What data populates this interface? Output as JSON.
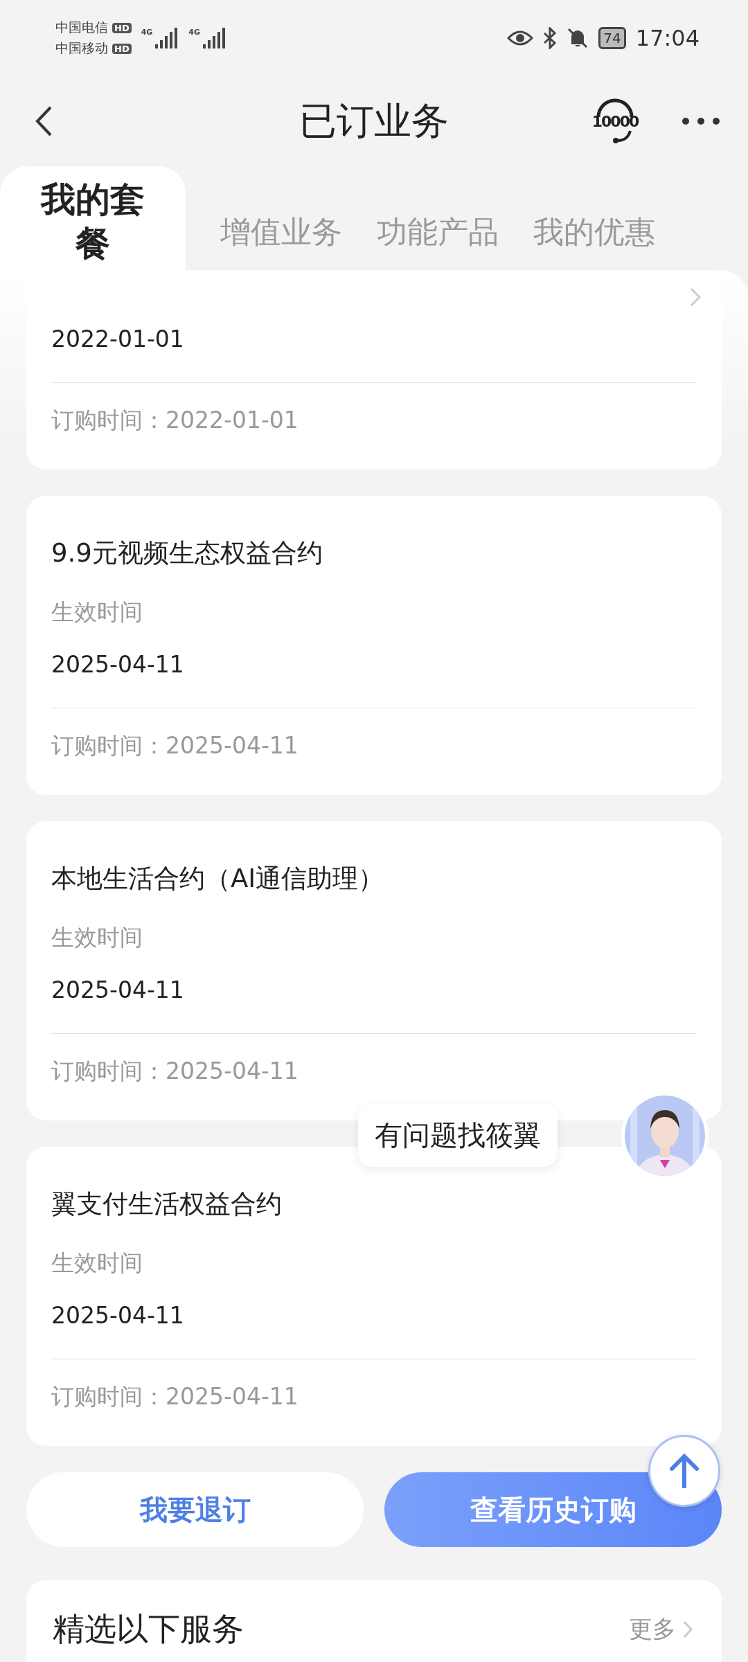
{
  "status_bar": {
    "carriers": [
      {
        "name": "中国电信",
        "badge": "HD",
        "network": "4G"
      },
      {
        "name": "中国移动",
        "badge": "HD",
        "network": "4G"
      }
    ],
    "battery": "74",
    "time": "17:04"
  },
  "header": {
    "title": "已订业务",
    "hotline": "10000"
  },
  "tabs": [
    {
      "label": "我的套餐",
      "selected": true
    },
    {
      "label": "增值业务",
      "selected": false
    },
    {
      "label": "功能产品",
      "selected": false
    },
    {
      "label": "我的优惠",
      "selected": false
    }
  ],
  "cards": [
    {
      "effective_date": "2022-01-01",
      "order_time": "订购时间：2022-01-01"
    },
    {
      "title": "9.9元视频生态权益合约",
      "effective_label": "生效时间",
      "effective_date": "2025-04-11",
      "order_time": "订购时间：2025-04-11"
    },
    {
      "title": "本地生活合约（AI通信助理）",
      "effective_label": "生效时间",
      "effective_date": "2025-04-11",
      "order_time": "订购时间：2025-04-11"
    },
    {
      "title": "翼支付生活权益合约",
      "effective_label": "生效时间",
      "effective_date": "2025-04-11",
      "order_time": "订购时间：2025-04-11"
    }
  ],
  "actions": {
    "unsubscribe": "我要退订",
    "history": "查看历史订购"
  },
  "services": {
    "title": "精选以下服务",
    "more": "更多"
  },
  "assistant": {
    "bubble": "有问题找筱翼"
  }
}
